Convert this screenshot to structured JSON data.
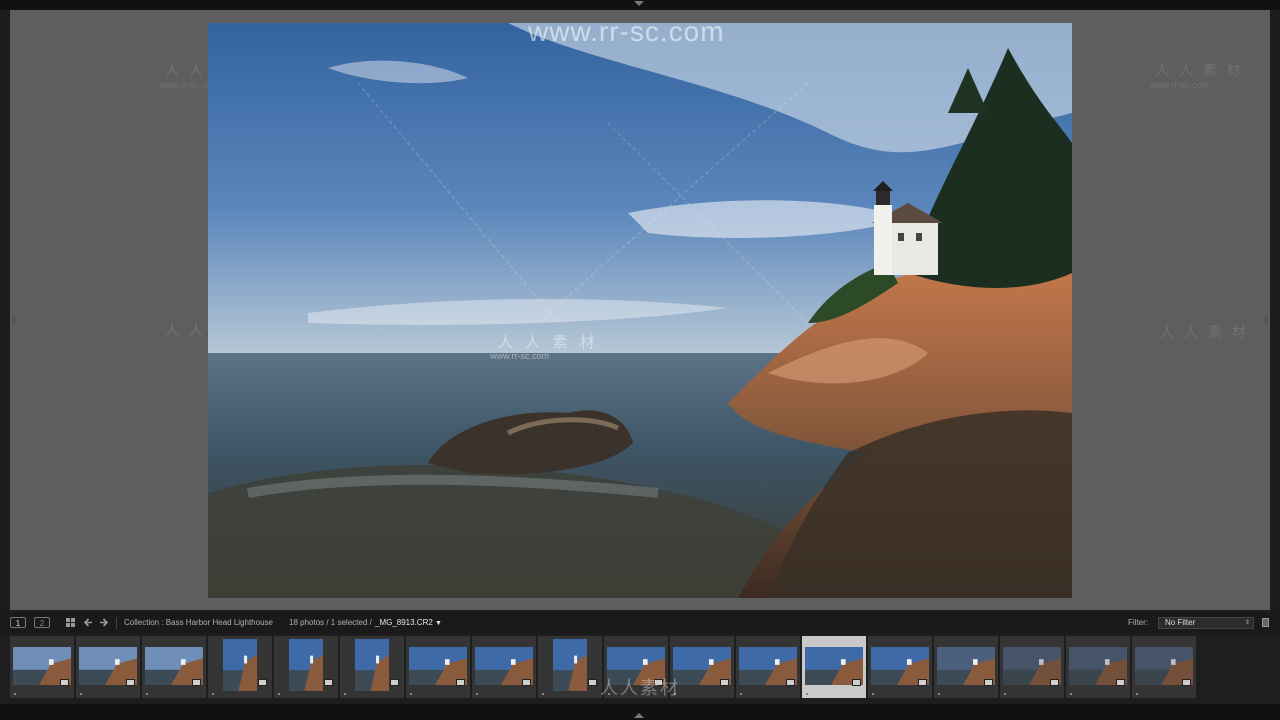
{
  "toolbar": {
    "view1_label": "1",
    "view2_label": "2",
    "collection_label": "Collection : Bass Harbor Head Lighthouse",
    "photo_count": "18 photos / 1 selected /",
    "filename": "_MG_8913.CR2",
    "filter_label": "Filter:",
    "filter_value": "No Filter"
  },
  "filmstrip": {
    "count": 18,
    "selected_index": 12
  },
  "watermarks": {
    "url_top": "www.rr-sc.com",
    "cn": "人 人 素 材",
    "url_small": "www.rr-sc.com",
    "bottom_logo": "人人素材"
  },
  "colors": {
    "sky_top": "#3e6fae",
    "sea": "#3d5565",
    "rock": "#b86c44",
    "panel": "#5e5e5e"
  }
}
